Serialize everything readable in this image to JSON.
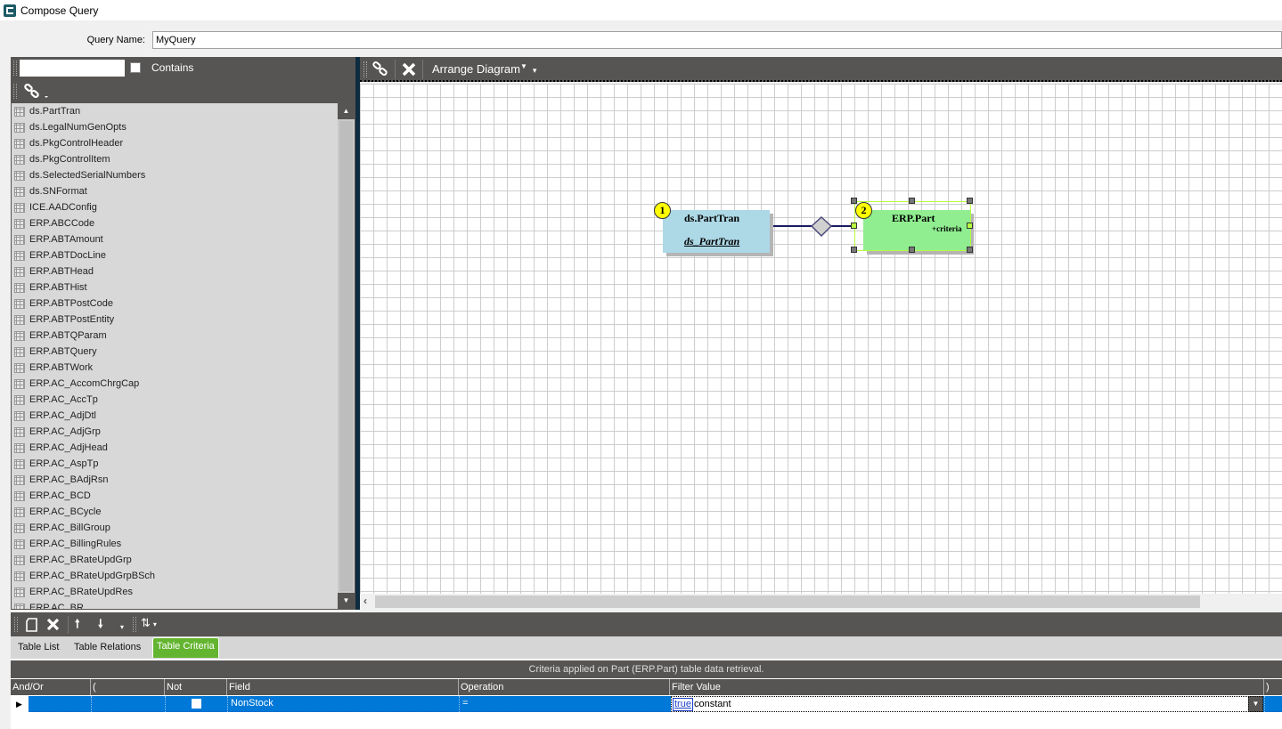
{
  "window": {
    "title": "Compose Query",
    "icon": "epicor-logo-icon"
  },
  "query": {
    "label": "Query Name:",
    "value": "MyQuery"
  },
  "table_search": {
    "value": "",
    "contains_label": "Contains",
    "contains_checked": false,
    "link_icon": "link-icon"
  },
  "table_list": {
    "items": [
      "ds.PartTran",
      "ds.LegalNumGenOpts",
      "ds.PkgControlHeader",
      "ds.PkgControlItem",
      "ds.SelectedSerialNumbers",
      "ds.SNFormat",
      "ICE.AADConfig",
      "ERP.ABCCode",
      "ERP.ABTAmount",
      "ERP.ABTDocLine",
      "ERP.ABTHead",
      "ERP.ABTHist",
      "ERP.ABTPostCode",
      "ERP.ABTPostEntity",
      "ERP.ABTQParam",
      "ERP.ABTQuery",
      "ERP.ABTWork",
      "ERP.AC_AccomChrgCap",
      "ERP.AC_AccTp",
      "ERP.AC_AdjDtl",
      "ERP.AC_AdjGrp",
      "ERP.AC_AdjHead",
      "ERP.AC_AspTp",
      "ERP.AC_BAdjRsn",
      "ERP.AC_BCD",
      "ERP.AC_BCycle",
      "ERP.AC_BillGroup",
      "ERP.AC_BillingRules",
      "ERP.AC_BRateUpdGrp",
      "ERP.AC_BRateUpdGrpBSch",
      "ERP.AC_BRateUpdRes",
      "ERP.AC_BR"
    ]
  },
  "diagram_toolbar": {
    "arrange_label": "Arrange Diagram"
  },
  "diagram": {
    "nodes": [
      {
        "badge": "1",
        "title": "ds.PartTran",
        "alias": "ds_PartTran",
        "color": "#add8e6"
      },
      {
        "badge": "2",
        "title": "ERP.Part",
        "note": "+criteria",
        "color": "#90ee90"
      }
    ]
  },
  "bottom_tabs": [
    {
      "label": "Table List",
      "active": false
    },
    {
      "label": "Table Relations",
      "active": false
    },
    {
      "label": "Table Criteria",
      "active": true
    }
  ],
  "criteria": {
    "caption": "Criteria applied on Part (ERP.Part)  table data retrieval.",
    "columns": [
      "And/Or",
      "(",
      "Not",
      "Field",
      "Operation",
      "Filter Value",
      ")"
    ],
    "rows": [
      {
        "and_or": "",
        "paren_open": "",
        "not": false,
        "field": "NonStock",
        "operation": "=",
        "filter_value": "true",
        "filter_type": "constant",
        "paren_close": ""
      }
    ]
  },
  "colors": {
    "accent_tab": "#63b52f",
    "selection": "#0078d7",
    "toolbar": "#575553"
  }
}
